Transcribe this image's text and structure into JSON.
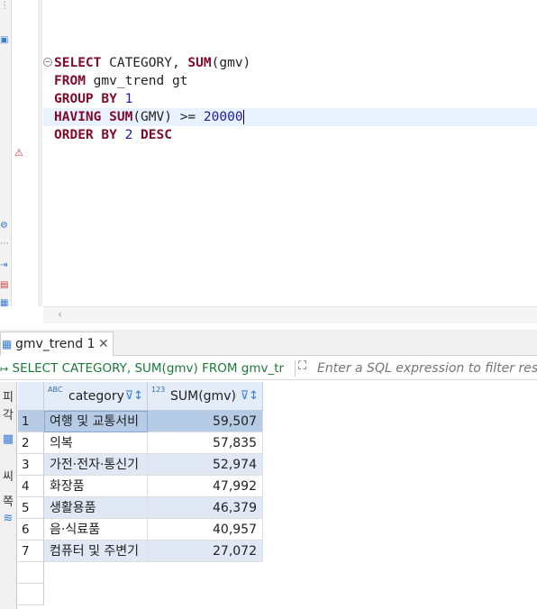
{
  "editor": {
    "lines": [
      [
        {
          "t": "SELECT",
          "k": "kw"
        },
        {
          "t": " CATEGORY, ",
          "k": ""
        },
        {
          "t": "SUM",
          "k": "kw"
        },
        {
          "t": "(gmv)",
          "k": ""
        }
      ],
      [
        {
          "t": "FROM",
          "k": "kw"
        },
        {
          "t": " gmv_trend gt",
          "k": ""
        }
      ],
      [
        {
          "t": "GROUP BY",
          "k": "kw"
        },
        {
          "t": " ",
          "k": ""
        },
        {
          "t": "1",
          "k": "num"
        }
      ],
      [
        {
          "t": "HAVING",
          "k": "kw"
        },
        {
          "t": " ",
          "k": ""
        },
        {
          "t": "SUM",
          "k": "kw"
        },
        {
          "t": "(GMV) >= ",
          "k": ""
        },
        {
          "t": "20000",
          "k": "num"
        }
      ],
      [
        {
          "t": "ORDER BY",
          "k": "kw"
        },
        {
          "t": " ",
          "k": ""
        },
        {
          "t": "2",
          "k": "num"
        },
        {
          "t": " ",
          "k": ""
        },
        {
          "t": "DESC",
          "k": "kw"
        }
      ]
    ],
    "current_line": 3,
    "keyword_color": "#7f0a2a",
    "number_color": "#1a1aa6"
  },
  "results": {
    "tab_label": "gmv_trend 1",
    "close_glyph": "✕",
    "query_preview": "SELECT CATEGORY, SUM(gmv) FROM gmv_tr",
    "filter_placeholder": "Enter a SQL expression to filter results",
    "columns": [
      {
        "type_badge": "ABC",
        "label": "category"
      },
      {
        "type_badge": "123",
        "label": "SUM(gmv)"
      }
    ],
    "rows": [
      {
        "n": "1",
        "category": "여행 및 교통서비",
        "sum": "59,507"
      },
      {
        "n": "2",
        "category": "의복",
        "sum": "57,835"
      },
      {
        "n": "3",
        "category": "가전·전자·통신기",
        "sum": "52,974"
      },
      {
        "n": "4",
        "category": "화장품",
        "sum": "47,992"
      },
      {
        "n": "5",
        "category": "생활용품",
        "sum": "46,379"
      },
      {
        "n": "6",
        "category": "음·식료품",
        "sum": "40,957"
      },
      {
        "n": "7",
        "category": "컴퓨터 및 주변기",
        "sum": "27,072"
      }
    ],
    "side_panel_labels": [
      "피",
      "각",
      "",
      "씨",
      "쪽"
    ]
  },
  "colors": {
    "header_bg": "#e4ecf7",
    "selected_row": "#b5cbe6",
    "alt_row": "#dfe8f4",
    "query_text": "#1b7a3a"
  }
}
